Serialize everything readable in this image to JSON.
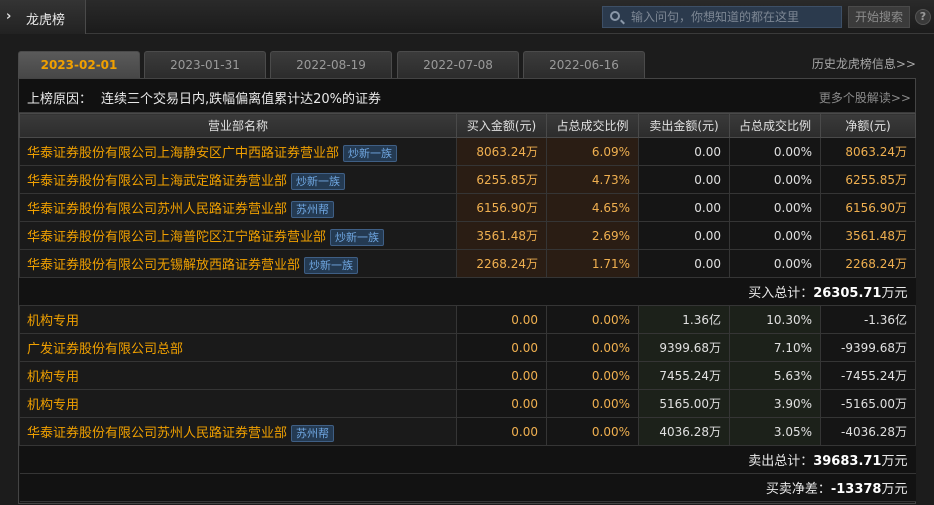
{
  "header": {
    "title": "龙虎榜",
    "search_placeholder": "输入问句，你想知道的都在这里",
    "search_button": "开始搜索",
    "help_label": "?"
  },
  "tabs": [
    "2023-02-01",
    "2023-01-31",
    "2022-08-19",
    "2022-07-08",
    "2022-06-16"
  ],
  "history_link": "历史龙虎榜信息>>",
  "reason": {
    "label": "上榜原因：",
    "text": "连续三个交易日内,跌幅偏离值累计达20%的证券",
    "more_link": "更多个股解读>>"
  },
  "columns": [
    "营业部名称",
    "买入金额(元)",
    "占总成交比例",
    "卖出金额(元)",
    "占总成交比例",
    "净额(元)"
  ],
  "buy_rows": [
    {
      "name": "华泰证券股份有限公司上海静安区广中西路证券营业部",
      "tag": "炒新一族",
      "buy": "8063.24万",
      "buy_pct": "6.09%",
      "sell": "0.00",
      "sell_pct": "0.00%",
      "net": "8063.24万"
    },
    {
      "name": "华泰证券股份有限公司上海武定路证券营业部",
      "tag": "炒新一族",
      "buy": "6255.85万",
      "buy_pct": "4.73%",
      "sell": "0.00",
      "sell_pct": "0.00%",
      "net": "6255.85万"
    },
    {
      "name": "华泰证券股份有限公司苏州人民路证券营业部",
      "tag": "苏州帮",
      "buy": "6156.90万",
      "buy_pct": "4.65%",
      "sell": "0.00",
      "sell_pct": "0.00%",
      "net": "6156.90万"
    },
    {
      "name": "华泰证券股份有限公司上海普陀区江宁路证券营业部",
      "tag": "炒新一族",
      "buy": "3561.48万",
      "buy_pct": "2.69%",
      "sell": "0.00",
      "sell_pct": "0.00%",
      "net": "3561.48万"
    },
    {
      "name": "华泰证券股份有限公司无锡解放西路证券营业部",
      "tag": "炒新一族",
      "buy": "2268.24万",
      "buy_pct": "1.71%",
      "sell": "0.00",
      "sell_pct": "0.00%",
      "net": "2268.24万"
    }
  ],
  "buy_total": {
    "label": "买入总计：",
    "value": "26305.71",
    "unit": "万元"
  },
  "sell_rows": [
    {
      "name": "机构专用",
      "tag": "",
      "buy": "0.00",
      "buy_pct": "0.00%",
      "sell": "1.36亿",
      "sell_pct": "10.30%",
      "net": "-1.36亿"
    },
    {
      "name": "广发证券股份有限公司总部",
      "tag": "",
      "buy": "0.00",
      "buy_pct": "0.00%",
      "sell": "9399.68万",
      "sell_pct": "7.10%",
      "net": "-9399.68万"
    },
    {
      "name": "机构专用",
      "tag": "",
      "buy": "0.00",
      "buy_pct": "0.00%",
      "sell": "7455.24万",
      "sell_pct": "5.63%",
      "net": "-7455.24万"
    },
    {
      "name": "机构专用",
      "tag": "",
      "buy": "0.00",
      "buy_pct": "0.00%",
      "sell": "5165.00万",
      "sell_pct": "3.90%",
      "net": "-5165.00万"
    },
    {
      "name": "华泰证券股份有限公司苏州人民路证券营业部",
      "tag": "苏州帮",
      "buy": "0.00",
      "buy_pct": "0.00%",
      "sell": "4036.28万",
      "sell_pct": "3.05%",
      "net": "-4036.28万"
    }
  ],
  "sell_total": {
    "label": "卖出总计：",
    "value": "39683.71",
    "unit": "万元"
  },
  "net_total": {
    "label": "买卖净差：",
    "value": "-13378",
    "unit": "万元"
  },
  "colors": {
    "accent": "#f0a000",
    "tag_bg": "#243a52",
    "tag_text": "#6fa6e0"
  }
}
